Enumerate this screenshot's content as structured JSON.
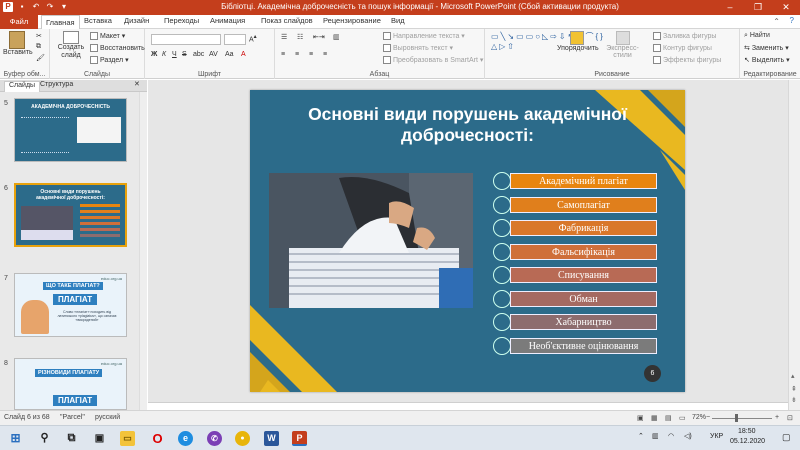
{
  "window": {
    "title": "Бібліотці. Академічна доброчесність та пошук інформації - Microsoft PowerPoint (Сбой активации продукта)"
  },
  "ribbon_tabs": [
    "Файл",
    "Главная",
    "Вставка",
    "Дизайн",
    "Переходы",
    "Анимация",
    "Показ слайдов",
    "Рецензирование",
    "Вид"
  ],
  "ribbon": {
    "paste": "Вставить",
    "clipboard_label": "Буфер обм...",
    "create_slide": "Создать слайд",
    "layout": "Макет",
    "reset": "Восстановить",
    "section": "Раздел",
    "slides_label": "Слайды",
    "font_label": "Шрифт",
    "text_direction": "Направление текста",
    "align_text": "Выровнять текст",
    "smartart": "Преобразовать в SmartArt",
    "paragraph_label": "Абзац",
    "arrange": "Упорядочить",
    "quick_styles": "Экспресс-стили",
    "shape_fill": "Заливка фигуры",
    "shape_outline": "Контур фигуры",
    "shape_effects": "Эффекты фигуры",
    "drawing_label": "Рисование",
    "find": "Найти",
    "replace": "Заменить",
    "select": "Выделить",
    "editing_label": "Редактирование"
  },
  "side_panel": {
    "tab_slides": "Слайды",
    "tab_outline": "Структура",
    "thumbnails": [
      {
        "num": "5",
        "title": "АКАДЕМІЧНА ДОБРОЧЕСНІСТЬ"
      },
      {
        "num": "6",
        "title": "Основні види порушень академічної доброчесності:"
      },
      {
        "num": "7",
        "title": "ЩО ТАКЕ ПЛАГІАТ?",
        "banner": "ПЛАГІАТ",
        "caption": "Слово «плагіат» походить від латинського «plagiatus», що означає «викрадений»",
        "site": "educ.org.ua"
      },
      {
        "num": "8",
        "title": "РІЗНОВИДИ ПЛАГІАТУ",
        "banner": "ПЛАГІАТ",
        "site": "educ.org.ua"
      }
    ]
  },
  "slide": {
    "title": "Основні види порушень академічної доброчесності:",
    "number": "6",
    "items": [
      {
        "label": "Академічний плагіат",
        "color": "#e8850f"
      },
      {
        "label": "Самоплагіат",
        "color": "#e07f1c"
      },
      {
        "label": "Фабрикація",
        "color": "#d9772a"
      },
      {
        "label": "Фальсифікація",
        "color": "#cf6f3a"
      },
      {
        "label": "Списування",
        "color": "#b86a55"
      },
      {
        "label": "Обман",
        "color": "#a56a62"
      },
      {
        "label": "Хабарництво",
        "color": "#8d6c6e"
      },
      {
        "label": "Необ'єктивне оцінювання",
        "color": "#7b7b7b"
      }
    ]
  },
  "status": {
    "slide_info": "Слайд 6 из 68",
    "theme": "\"Parcel\"",
    "language": "русский",
    "zoom": "72%"
  },
  "taskbar": {
    "language": "УКР",
    "time": "18:50",
    "date": "05.12.2020"
  }
}
